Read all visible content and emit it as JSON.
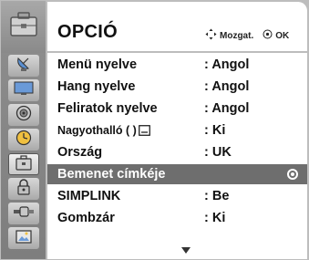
{
  "header": {
    "title": "OPCIÓ",
    "nav_hint": "Mozgat.",
    "ok_hint": "OK"
  },
  "sidebar": {
    "top_icon": "toolbox-icon",
    "items": [
      {
        "icon": "satellite-dish-icon"
      },
      {
        "icon": "tv-screen-icon"
      },
      {
        "icon": "speaker-icon"
      },
      {
        "icon": "clock-icon"
      },
      {
        "icon": "option-toolbox-icon",
        "active": true
      },
      {
        "icon": "lock-icon"
      },
      {
        "icon": "connector-icon"
      },
      {
        "icon": "picture-icon"
      }
    ]
  },
  "menu": {
    "rows": [
      {
        "label": "Menü nyelve",
        "value": ": Angol"
      },
      {
        "label": "Hang nyelve",
        "value": ": Angol"
      },
      {
        "label": "Feliratok nyelve",
        "value": ": Angol"
      },
      {
        "label": "Nagyothalló (     )",
        "value": ": Ki"
      },
      {
        "label": "Ország",
        "value": ": UK"
      },
      {
        "label": "Bemenet címkéje",
        "value": ""
      },
      {
        "label": "SIMPLINK",
        "value": ": Be"
      },
      {
        "label": "Gombzár",
        "value": ": Ki"
      }
    ]
  },
  "colors": {
    "highlight": "#6e6e6e",
    "sidebar": "#858585",
    "text": "#111111"
  }
}
